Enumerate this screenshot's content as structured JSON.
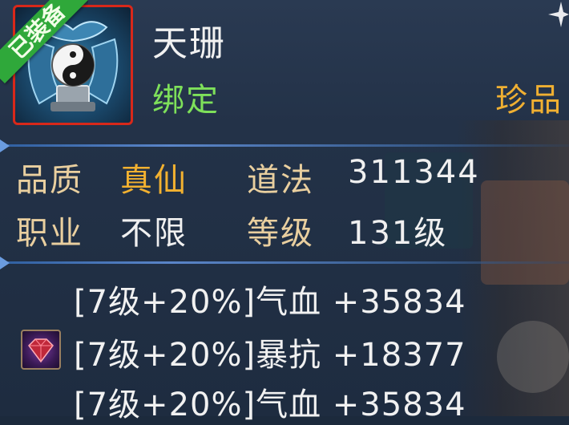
{
  "item": {
    "name": "天珊",
    "bind_status": "绑定",
    "rarity": "珍品",
    "equipped_ribbon": "已装备",
    "icon": "taiji-ornament-icon"
  },
  "stats": [
    {
      "label": "品质",
      "value": "真仙",
      "highlight": true
    },
    {
      "label": "道法",
      "value": "311344",
      "highlight": false
    },
    {
      "label": "职业",
      "value": "不限",
      "highlight": false
    },
    {
      "label": "等级",
      "value": "131级",
      "highlight": false
    }
  ],
  "gems": {
    "icon": "ruby-gem-icon",
    "lines": [
      "[7级+20%]气血 +35834",
      "[7级+20%]暴抗 +18377",
      "[7级+20%]气血 +35834"
    ]
  },
  "colors": {
    "bind": "#7ee05a",
    "rarity": "#f0b032",
    "quality": "#f2b130",
    "label": "#e9cf9f",
    "ribbon": "#2fa83a",
    "frame": "#d8281a"
  }
}
